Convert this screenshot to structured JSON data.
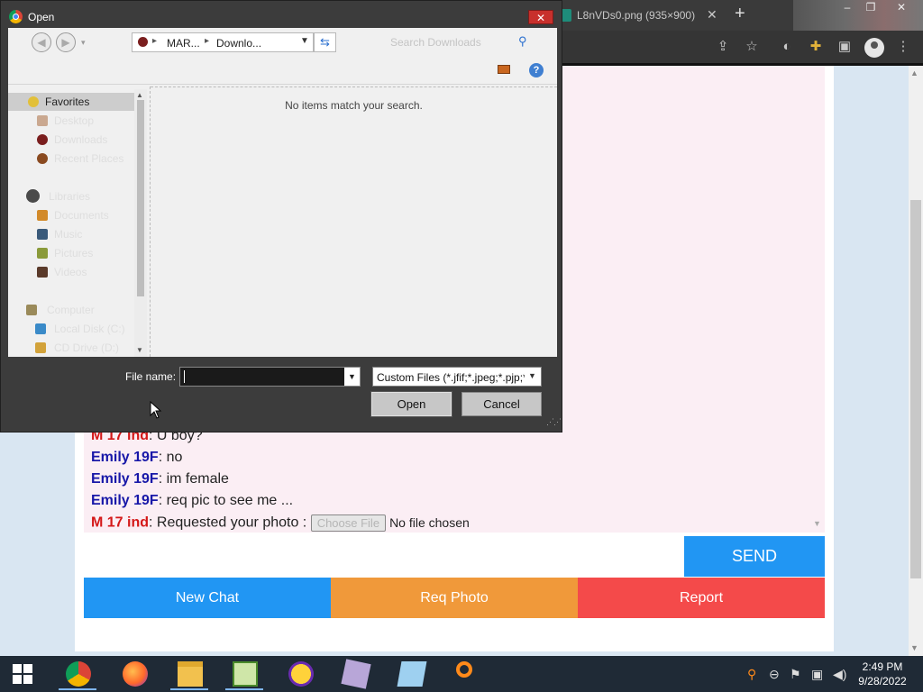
{
  "browser": {
    "tab_title": "L8nVDs0.png (935×900)",
    "tab_close": "✕",
    "new_tab": "+",
    "window_controls": [
      "–",
      "❐",
      "✕"
    ]
  },
  "chat": {
    "messages": [
      {
        "sender": "M 17 ind",
        "text": ": U boy?"
      },
      {
        "sender": "Emily 19F",
        "text": ": no"
      },
      {
        "sender": "Emily 19F",
        "text": ": im female"
      },
      {
        "sender": "Emily 19F",
        "text": ": req pic to see me ..."
      },
      {
        "sender": "M 17 ind",
        "text": ": Requested your photo : "
      }
    ],
    "choose_file_label": "Choose File",
    "no_file_text": "No file chosen",
    "send_label": "SEND",
    "actions": {
      "new_chat": "New Chat",
      "req_photo": "Req Photo",
      "report": "Report"
    },
    "colors": {
      "blue": "#2196f3",
      "orange": "#f0993a",
      "red": "#f44a4a",
      "male": "#d41818",
      "female": "#1818a8"
    }
  },
  "dialog": {
    "title": "Open",
    "close": "✕",
    "breadcrumb": [
      "MAR...",
      "Downlo..."
    ],
    "search_placeholder": "Search Downloads",
    "empty_message": "No items match your search.",
    "help": "?",
    "nav": [
      {
        "label": "Favorites",
        "icon": "star-icon",
        "selected": true
      },
      {
        "label": "Desktop",
        "icon": "desktop-icon"
      },
      {
        "label": "Downloads",
        "icon": "downloads-icon"
      },
      {
        "label": "Recent Places",
        "icon": "recent-places-icon"
      },
      {
        "label": "Libraries",
        "icon": "libraries-icon"
      },
      {
        "label": "Documents",
        "icon": "documents-icon"
      },
      {
        "label": "Music",
        "icon": "music-icon"
      },
      {
        "label": "Pictures",
        "icon": "pictures-icon"
      },
      {
        "label": "Videos",
        "icon": "videos-icon"
      },
      {
        "label": "Computer",
        "icon": "computer-icon"
      },
      {
        "label": "Local Disk (C:)",
        "icon": "disk-icon"
      },
      {
        "label": "CD Drive (D:)",
        "icon": "cd-drive-icon"
      }
    ],
    "file_name_label": "File name:",
    "file_name_value": "",
    "file_type": "Custom Files (*.jfif;*.jpeg;*.pjp;*",
    "open_label": "Open",
    "cancel_label": "Cancel"
  },
  "taskbar": {
    "apps": [
      "chrome",
      "firefox",
      "file-explorer",
      "notepad-plus",
      "yahoo-messenger",
      "wizard",
      "notepad",
      "search-tool"
    ],
    "clock_time": "2:49 PM",
    "clock_date": "9/28/2022"
  }
}
